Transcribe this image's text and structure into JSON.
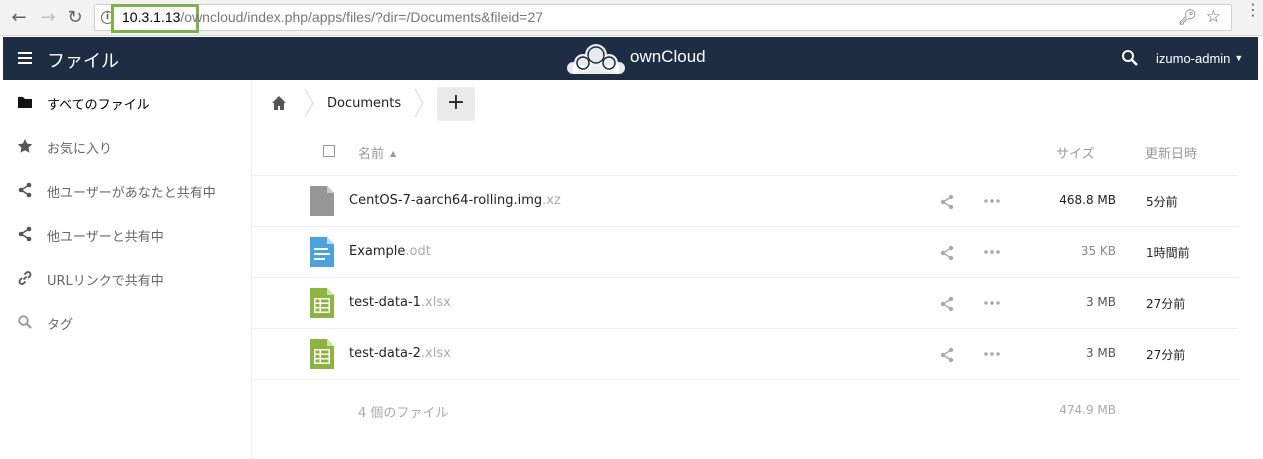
{
  "browser": {
    "url_host": "10.3.1.13",
    "url_path": "/owncloud/index.php/apps/files/?dir=/Documents&fileid=27"
  },
  "header": {
    "app_title": "ファイル",
    "brand": "ownCloud",
    "user": "izumo-admin"
  },
  "sidebar": {
    "items": [
      {
        "label": "すべてのファイル",
        "icon": "folder-icon"
      },
      {
        "label": "お気に入り",
        "icon": "star-icon"
      },
      {
        "label": "他ユーザーがあなたと共有中",
        "icon": "share-icon"
      },
      {
        "label": "他ユーザーと共有中",
        "icon": "share-icon"
      },
      {
        "label": "URLリンクで共有中",
        "icon": "link-icon"
      },
      {
        "label": "タグ",
        "icon": "search-icon"
      }
    ]
  },
  "breadcrumb": {
    "folder": "Documents",
    "add_label": "+"
  },
  "table": {
    "col_name": "名前",
    "col_size": "サイズ",
    "col_modified": "更新日時",
    "rows": [
      {
        "name": "CentOS-7-aarch64-rolling.img",
        "ext": ".xz",
        "size": "468.8 MB",
        "modified": "5分前",
        "type": "archive"
      },
      {
        "name": "Example",
        "ext": ".odt",
        "size": "35 KB",
        "modified": "1時間前",
        "type": "document"
      },
      {
        "name": "test-data-1",
        "ext": ".xlsx",
        "size": "3 MB",
        "modified": "27分前",
        "type": "spreadsheet"
      },
      {
        "name": "test-data-2",
        "ext": ".xlsx",
        "size": "3 MB",
        "modified": "27分前",
        "type": "spreadsheet"
      }
    ],
    "summary_count": "4 個のファイル",
    "summary_size": "474.9 MB"
  },
  "colors": {
    "header_bg": "#1d2d44",
    "doc_blue": "#4aa3df",
    "sheet_green": "#8bb53e",
    "archive_gray": "#969696",
    "highlight_green": "#7cb342"
  }
}
